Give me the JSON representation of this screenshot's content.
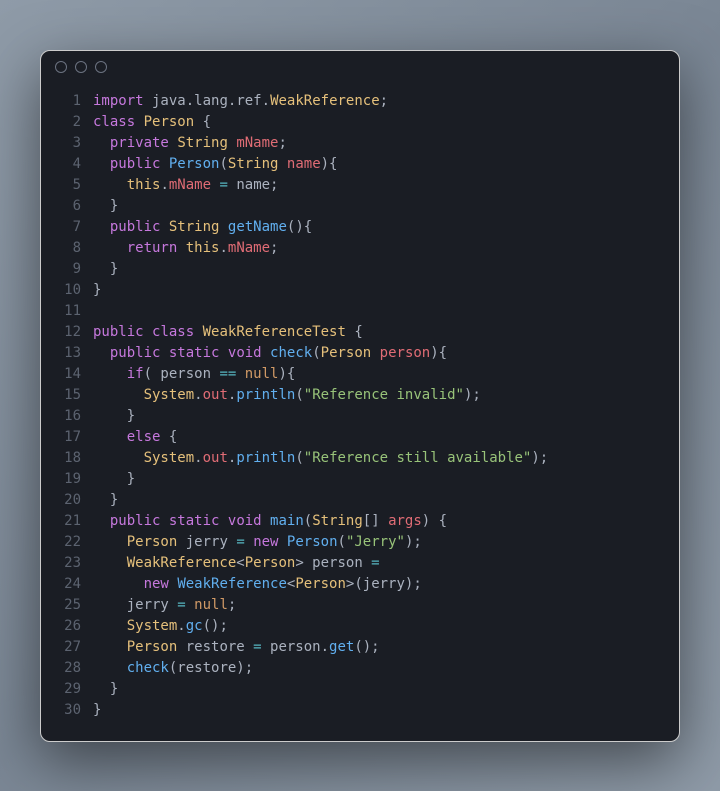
{
  "colors": {
    "background": "#1a1d24",
    "lineno": "#5c6370",
    "default": "#abb2bf",
    "keyword": "#c678dd",
    "type": "#e5c07b",
    "string": "#98c379",
    "function": "#61afef",
    "variable": "#e06c75",
    "literal": "#d19a66",
    "operator": "#56b6c2"
  },
  "code": {
    "language": "java",
    "lines": [
      {
        "n": 1,
        "tokens": [
          [
            "k",
            "import"
          ],
          [
            "p",
            " java"
          ],
          [
            "p",
            "."
          ],
          [
            "p",
            "lang"
          ],
          [
            "p",
            "."
          ],
          [
            "p",
            "ref"
          ],
          [
            "p",
            "."
          ],
          [
            "t",
            "WeakReference"
          ],
          [
            "p",
            ";"
          ]
        ]
      },
      {
        "n": 2,
        "tokens": [
          [
            "k",
            "class"
          ],
          [
            "p",
            " "
          ],
          [
            "t",
            "Person"
          ],
          [
            "p",
            " {"
          ]
        ]
      },
      {
        "n": 3,
        "tokens": [
          [
            "p",
            "  "
          ],
          [
            "k",
            "private"
          ],
          [
            "p",
            " "
          ],
          [
            "t",
            "String"
          ],
          [
            "p",
            " "
          ],
          [
            "v",
            "mName"
          ],
          [
            "p",
            ";"
          ]
        ]
      },
      {
        "n": 4,
        "tokens": [
          [
            "p",
            "  "
          ],
          [
            "k",
            "public"
          ],
          [
            "p",
            " "
          ],
          [
            "f",
            "Person"
          ],
          [
            "p",
            "("
          ],
          [
            "t",
            "String"
          ],
          [
            "p",
            " "
          ],
          [
            "v",
            "name"
          ],
          [
            "p",
            "){"
          ]
        ]
      },
      {
        "n": 5,
        "tokens": [
          [
            "p",
            "    "
          ],
          [
            "th",
            "this"
          ],
          [
            "p",
            "."
          ],
          [
            "v",
            "mName"
          ],
          [
            "p",
            " "
          ],
          [
            "op",
            "="
          ],
          [
            "p",
            " name;"
          ]
        ]
      },
      {
        "n": 6,
        "tokens": [
          [
            "p",
            "  }"
          ]
        ]
      },
      {
        "n": 7,
        "tokens": [
          [
            "p",
            "  "
          ],
          [
            "k",
            "public"
          ],
          [
            "p",
            " "
          ],
          [
            "t",
            "String"
          ],
          [
            "p",
            " "
          ],
          [
            "f",
            "getName"
          ],
          [
            "p",
            "(){"
          ]
        ]
      },
      {
        "n": 8,
        "tokens": [
          [
            "p",
            "    "
          ],
          [
            "k",
            "return"
          ],
          [
            "p",
            " "
          ],
          [
            "th",
            "this"
          ],
          [
            "p",
            "."
          ],
          [
            "v",
            "mName"
          ],
          [
            "p",
            ";"
          ]
        ]
      },
      {
        "n": 9,
        "tokens": [
          [
            "p",
            "  }"
          ]
        ]
      },
      {
        "n": 10,
        "tokens": [
          [
            "p",
            "}"
          ]
        ]
      },
      {
        "n": 11,
        "tokens": [
          [
            "p",
            ""
          ]
        ]
      },
      {
        "n": 12,
        "tokens": [
          [
            "k",
            "public"
          ],
          [
            "p",
            " "
          ],
          [
            "k",
            "class"
          ],
          [
            "p",
            " "
          ],
          [
            "t",
            "WeakReferenceTest"
          ],
          [
            "p",
            " {"
          ]
        ]
      },
      {
        "n": 13,
        "tokens": [
          [
            "p",
            "  "
          ],
          [
            "k",
            "public"
          ],
          [
            "p",
            " "
          ],
          [
            "k",
            "static"
          ],
          [
            "p",
            " "
          ],
          [
            "k",
            "void"
          ],
          [
            "p",
            " "
          ],
          [
            "f",
            "check"
          ],
          [
            "p",
            "("
          ],
          [
            "t",
            "Person"
          ],
          [
            "p",
            " "
          ],
          [
            "v",
            "person"
          ],
          [
            "p",
            "){"
          ]
        ]
      },
      {
        "n": 14,
        "tokens": [
          [
            "p",
            "    "
          ],
          [
            "k",
            "if"
          ],
          [
            "p",
            "( person "
          ],
          [
            "op",
            "=="
          ],
          [
            "p",
            " "
          ],
          [
            "n",
            "null"
          ],
          [
            "p",
            "){"
          ]
        ]
      },
      {
        "n": 15,
        "tokens": [
          [
            "p",
            "      "
          ],
          [
            "t",
            "System"
          ],
          [
            "p",
            "."
          ],
          [
            "v",
            "out"
          ],
          [
            "p",
            "."
          ],
          [
            "f",
            "println"
          ],
          [
            "p",
            "("
          ],
          [
            "s",
            "\"Reference invalid\""
          ],
          [
            "p",
            ");"
          ]
        ]
      },
      {
        "n": 16,
        "tokens": [
          [
            "p",
            "    }"
          ]
        ]
      },
      {
        "n": 17,
        "tokens": [
          [
            "p",
            "    "
          ],
          [
            "k",
            "else"
          ],
          [
            "p",
            " {"
          ]
        ]
      },
      {
        "n": 18,
        "tokens": [
          [
            "p",
            "      "
          ],
          [
            "t",
            "System"
          ],
          [
            "p",
            "."
          ],
          [
            "v",
            "out"
          ],
          [
            "p",
            "."
          ],
          [
            "f",
            "println"
          ],
          [
            "p",
            "("
          ],
          [
            "s",
            "\"Reference still available\""
          ],
          [
            "p",
            ");"
          ]
        ]
      },
      {
        "n": 19,
        "tokens": [
          [
            "p",
            "    }"
          ]
        ]
      },
      {
        "n": 20,
        "tokens": [
          [
            "p",
            "  }"
          ]
        ]
      },
      {
        "n": 21,
        "tokens": [
          [
            "p",
            "  "
          ],
          [
            "k",
            "public"
          ],
          [
            "p",
            " "
          ],
          [
            "k",
            "static"
          ],
          [
            "p",
            " "
          ],
          [
            "k",
            "void"
          ],
          [
            "p",
            " "
          ],
          [
            "f",
            "main"
          ],
          [
            "p",
            "("
          ],
          [
            "t",
            "String"
          ],
          [
            "p",
            "[] "
          ],
          [
            "v",
            "args"
          ],
          [
            "p",
            ") {"
          ]
        ]
      },
      {
        "n": 22,
        "tokens": [
          [
            "p",
            "    "
          ],
          [
            "t",
            "Person"
          ],
          [
            "p",
            " jerry "
          ],
          [
            "op",
            "="
          ],
          [
            "p",
            " "
          ],
          [
            "k",
            "new"
          ],
          [
            "p",
            " "
          ],
          [
            "f",
            "Person"
          ],
          [
            "p",
            "("
          ],
          [
            "s",
            "\"Jerry\""
          ],
          [
            "p",
            ");"
          ]
        ]
      },
      {
        "n": 23,
        "tokens": [
          [
            "p",
            "    "
          ],
          [
            "t",
            "WeakReference"
          ],
          [
            "p",
            "<"
          ],
          [
            "t",
            "Person"
          ],
          [
            "p",
            "> person "
          ],
          [
            "op",
            "="
          ]
        ]
      },
      {
        "n": 24,
        "tokens": [
          [
            "p",
            "      "
          ],
          [
            "k",
            "new"
          ],
          [
            "p",
            " "
          ],
          [
            "f",
            "WeakReference"
          ],
          [
            "p",
            "<"
          ],
          [
            "t",
            "Person"
          ],
          [
            "p",
            ">(jerry);"
          ]
        ]
      },
      {
        "n": 25,
        "tokens": [
          [
            "p",
            "    jerry "
          ],
          [
            "op",
            "="
          ],
          [
            "p",
            " "
          ],
          [
            "n",
            "null"
          ],
          [
            "p",
            ";"
          ]
        ]
      },
      {
        "n": 26,
        "tokens": [
          [
            "p",
            "    "
          ],
          [
            "t",
            "System"
          ],
          [
            "p",
            "."
          ],
          [
            "f",
            "gc"
          ],
          [
            "p",
            "();"
          ]
        ]
      },
      {
        "n": 27,
        "tokens": [
          [
            "p",
            "    "
          ],
          [
            "t",
            "Person"
          ],
          [
            "p",
            " restore "
          ],
          [
            "op",
            "="
          ],
          [
            "p",
            " person."
          ],
          [
            "f",
            "get"
          ],
          [
            "p",
            "();"
          ]
        ]
      },
      {
        "n": 28,
        "tokens": [
          [
            "p",
            "    "
          ],
          [
            "f",
            "check"
          ],
          [
            "p",
            "(restore);"
          ]
        ]
      },
      {
        "n": 29,
        "tokens": [
          [
            "p",
            "  }"
          ]
        ]
      },
      {
        "n": 30,
        "tokens": [
          [
            "p",
            "}"
          ]
        ]
      }
    ]
  }
}
